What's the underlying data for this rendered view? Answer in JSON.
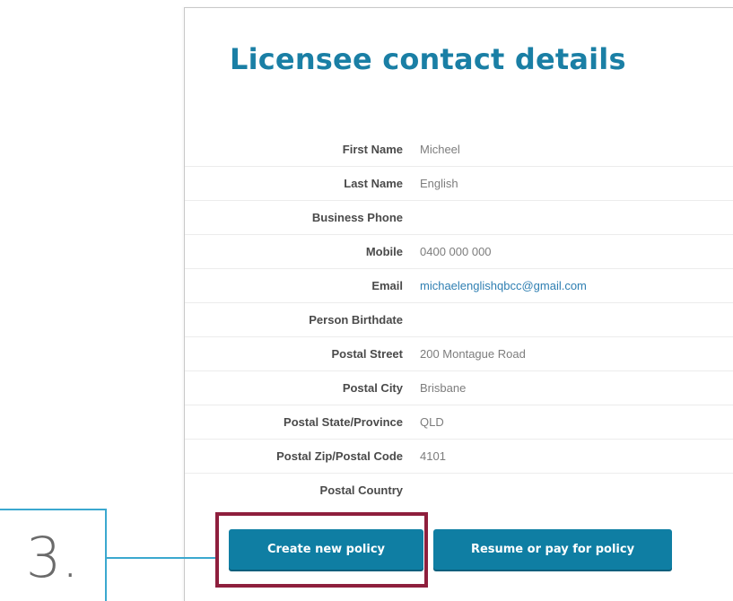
{
  "page": {
    "title": "Licensee contact details"
  },
  "details": [
    {
      "label": "First Name",
      "value": "Micheel",
      "is_link": false
    },
    {
      "label": "Last Name",
      "value": "English",
      "is_link": false
    },
    {
      "label": "Business Phone",
      "value": "",
      "is_link": false
    },
    {
      "label": "Mobile",
      "value": "0400 000 000",
      "is_link": false
    },
    {
      "label": "Email",
      "value": "michaelenglishqbcc@gmail.com",
      "is_link": true
    },
    {
      "label": "Person Birthdate",
      "value": "",
      "is_link": false
    },
    {
      "label": "Postal Street",
      "value": "200 Montague Road",
      "is_link": false
    },
    {
      "label": "Postal City",
      "value": "Brisbane",
      "is_link": false
    },
    {
      "label": "Postal State/Province",
      "value": "QLD",
      "is_link": false
    },
    {
      "label": "Postal Zip/Postal Code",
      "value": "4101",
      "is_link": false
    },
    {
      "label": "Postal Country",
      "value": "",
      "is_link": false
    }
  ],
  "actions": {
    "create_label": "Create new policy",
    "resume_label": "Resume or pay for policy"
  },
  "annotation": {
    "step": "3."
  },
  "colors": {
    "accent": "#1a7fa5",
    "button": "#0f7ea3",
    "highlight": "#8e1f3d",
    "callout": "#3ba8cf"
  }
}
